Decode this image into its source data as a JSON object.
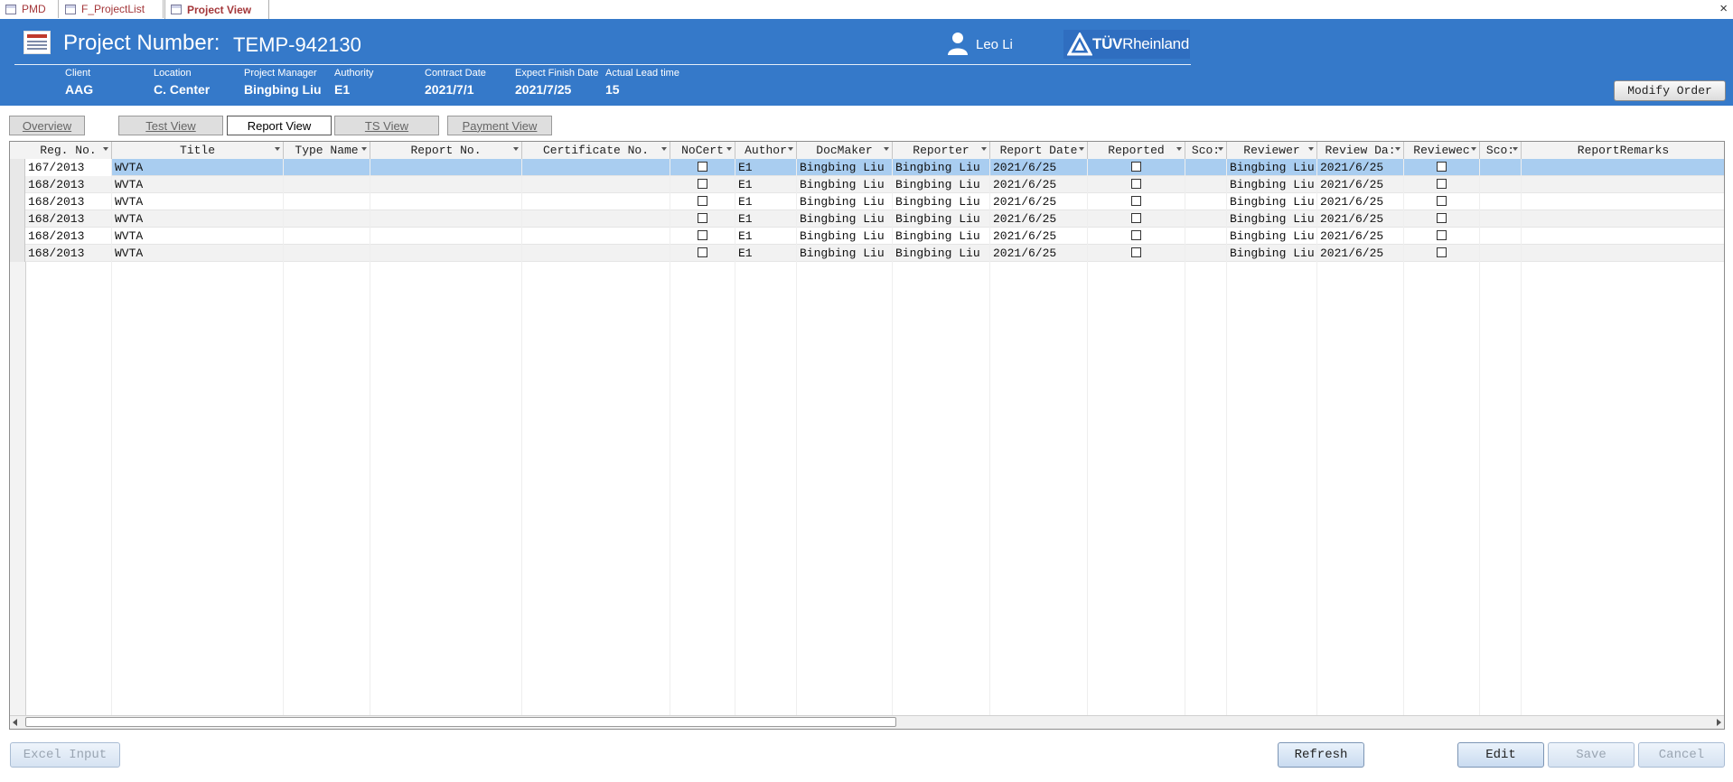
{
  "doc_tabs": [
    {
      "label": "PMD",
      "active": false
    },
    {
      "label": "F_ProjectList",
      "active": false
    },
    {
      "label": "Project View",
      "active": true
    }
  ],
  "window": {
    "close_label": "×"
  },
  "header": {
    "title_label": "Project Number:",
    "project_number": "TEMP-942130",
    "user_name": "Leo Li",
    "logo_main": "TÜV",
    "logo_sub": "Rheinland",
    "brand_color": "#3579c9"
  },
  "meta": {
    "client": {
      "label": "Client",
      "value": "AAG"
    },
    "location": {
      "label": "Location",
      "value": "C. Center"
    },
    "project_manager": {
      "label": "Project Manager",
      "value": "Bingbing Liu"
    },
    "authority": {
      "label": "Authority",
      "value": "E1"
    },
    "contract_date": {
      "label": "Contract Date",
      "value": "2021/7/1"
    },
    "expect_finish_date": {
      "label": "Expect Finish Date",
      "value": "2021/7/25"
    },
    "actual_lead_time": {
      "label": "Actual Lead time",
      "value": "15"
    }
  },
  "modify_order_label": "Modify Order",
  "view_tabs": [
    {
      "label": "Overview",
      "active": false
    },
    {
      "label": "Test View",
      "active": false
    },
    {
      "label": "Report View",
      "active": true
    },
    {
      "label": "TS View",
      "active": false
    },
    {
      "label": "Payment View",
      "active": false
    }
  ],
  "table": {
    "columns": [
      "Reg. No.",
      "Title",
      "Type Name",
      "Report No.",
      "Certificate No.",
      "NoCert",
      "Author",
      "DocMaker",
      "Reporter",
      "Report Date",
      "Reported",
      "Sco:",
      "Reviewer",
      "Review Da:",
      "Reviewec",
      "Sco:",
      "ReportRemarks"
    ],
    "rows": [
      {
        "reg_no": "167/2013",
        "title": "WVTA",
        "type_name": "",
        "report_no": "",
        "certificate_no": "",
        "nocert": false,
        "author": "E1",
        "docmaker": "Bingbing Liu",
        "reporter": "Bingbing Liu",
        "report_date": "2021/6/25",
        "reported": false,
        "score1": "",
        "reviewer": "Bingbing Liu",
        "review_date": "2021/6/25",
        "reviewed": false,
        "score2": "",
        "remarks": ""
      },
      {
        "reg_no": "168/2013",
        "title": "WVTA",
        "type_name": "",
        "report_no": "",
        "certificate_no": "",
        "nocert": false,
        "author": "E1",
        "docmaker": "Bingbing Liu",
        "reporter": "Bingbing Liu",
        "report_date": "2021/6/25",
        "reported": false,
        "score1": "",
        "reviewer": "Bingbing Liu",
        "review_date": "2021/6/25",
        "reviewed": false,
        "score2": "",
        "remarks": ""
      },
      {
        "reg_no": "168/2013",
        "title": "WVTA",
        "type_name": "",
        "report_no": "",
        "certificate_no": "",
        "nocert": false,
        "author": "E1",
        "docmaker": "Bingbing Liu",
        "reporter": "Bingbing Liu",
        "report_date": "2021/6/25",
        "reported": false,
        "score1": "",
        "reviewer": "Bingbing Liu",
        "review_date": "2021/6/25",
        "reviewed": false,
        "score2": "",
        "remarks": ""
      },
      {
        "reg_no": "168/2013",
        "title": "WVTA",
        "type_name": "",
        "report_no": "",
        "certificate_no": "",
        "nocert": false,
        "author": "E1",
        "docmaker": "Bingbing Liu",
        "reporter": "Bingbing Liu",
        "report_date": "2021/6/25",
        "reported": false,
        "score1": "",
        "reviewer": "Bingbing Liu",
        "review_date": "2021/6/25",
        "reviewed": false,
        "score2": "",
        "remarks": ""
      },
      {
        "reg_no": "168/2013",
        "title": "WVTA",
        "type_name": "",
        "report_no": "",
        "certificate_no": "",
        "nocert": false,
        "author": "E1",
        "docmaker": "Bingbing Liu",
        "reporter": "Bingbing Liu",
        "report_date": "2021/6/25",
        "reported": false,
        "score1": "",
        "reviewer": "Bingbing Liu",
        "review_date": "2021/6/25",
        "reviewed": false,
        "score2": "",
        "remarks": ""
      },
      {
        "reg_no": "168/2013",
        "title": "WVTA",
        "type_name": "",
        "report_no": "",
        "certificate_no": "",
        "nocert": false,
        "author": "E1",
        "docmaker": "Bingbing Liu",
        "reporter": "Bingbing Liu",
        "report_date": "2021/6/25",
        "reported": false,
        "score1": "",
        "reviewer": "Bingbing Liu",
        "review_date": "2021/6/25",
        "reviewed": false,
        "score2": "",
        "remarks": ""
      }
    ]
  },
  "buttons": {
    "excel_input": "Excel Input",
    "refresh": "Refresh",
    "edit": "Edit",
    "save": "Save",
    "cancel": "Cancel"
  }
}
